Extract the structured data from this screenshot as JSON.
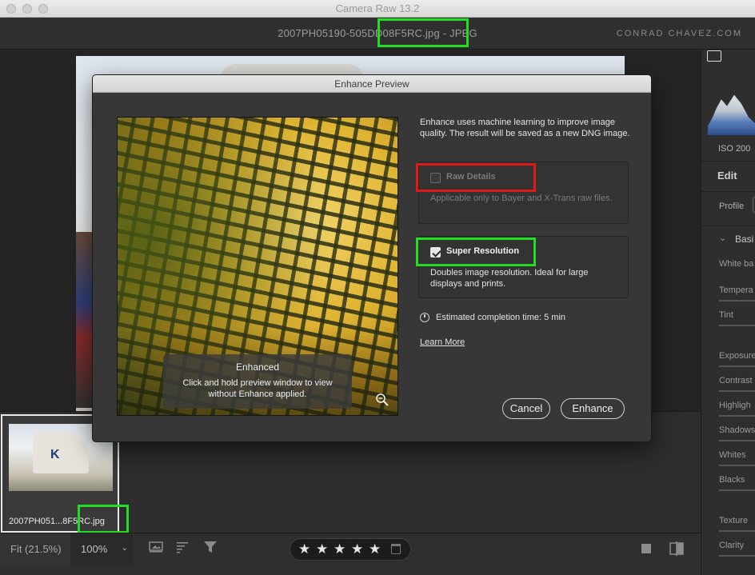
{
  "window": {
    "title": "Camera Raw 13.2"
  },
  "header": {
    "filename": "2007PH05190-505DD08F5RC.jpg  -  JPEG",
    "brand": "CONRAD CHAVEZ.COM"
  },
  "filmstrip": {
    "thumb_caption": "2007PH051...8F5RC.jpg"
  },
  "toolbar": {
    "fit_label": "Fit (21.5%)",
    "zoom_label": "100%",
    "zoom_caret": "⌄",
    "star_glyph": "★",
    "rating_stars": 5
  },
  "right_panel": {
    "iso": "ISO 200",
    "edit": "Edit",
    "profile": "Profile",
    "basic": "Basi",
    "basic_chevron": "⌄",
    "white_balance": "White ba",
    "temperature": "Tempera",
    "tint": "Tint",
    "exposure": "Exposure",
    "contrast": "Contrast",
    "highlights": "Highligh",
    "shadows": "Shadows",
    "whites": "Whites",
    "blacks": "Blacks",
    "texture": "Texture",
    "clarity": "Clarity"
  },
  "dialog": {
    "title": "Enhance Preview",
    "description": "Enhance uses machine learning to improve image quality. The result will be saved as a new DNG image.",
    "raw_details": {
      "label": "Raw Details",
      "checked": false,
      "desc": "Applicable only to Bayer and X-Trans raw files."
    },
    "super_resolution": {
      "label": "Super Resolution",
      "checked": true,
      "desc": "Doubles image resolution. Ideal for large displays and prints."
    },
    "estimate": "Estimated completion time: 5 min",
    "learn_more": "Learn More",
    "preview_tooltip": {
      "title": "Enhanced",
      "body": "Click and hold preview window to view without Enhance applied."
    },
    "cancel": "Cancel",
    "enhance": "Enhance"
  },
  "colors": {
    "highlight_green": "#22dd22",
    "highlight_red": "#e01a1a"
  }
}
